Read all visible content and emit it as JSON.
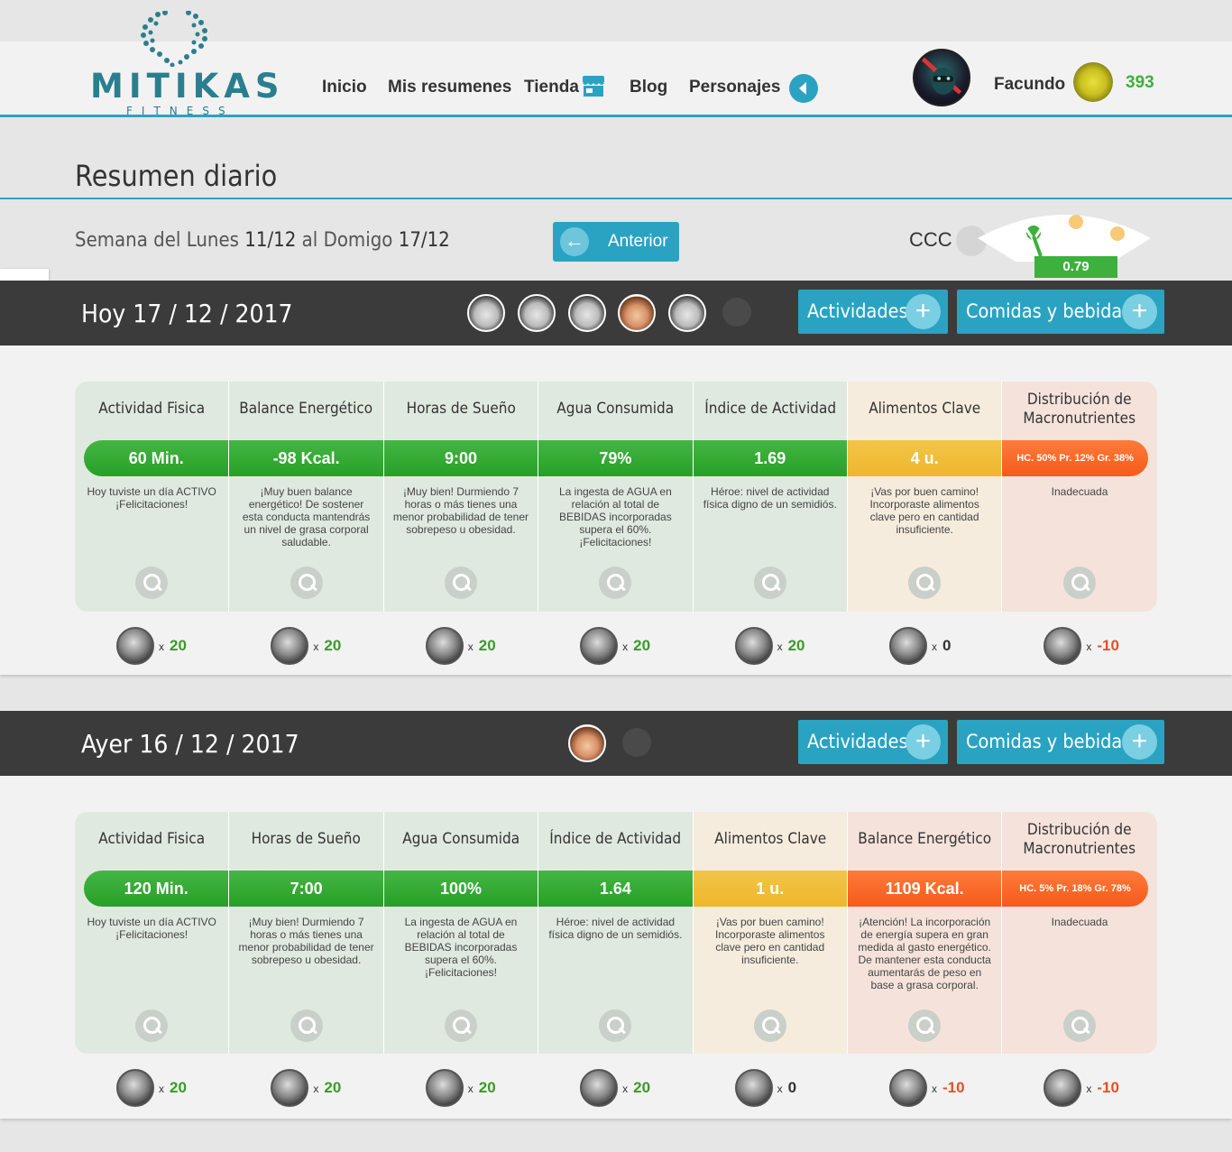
{
  "app": {
    "brand": "MITIKAS",
    "brand_sub": "FITNESS"
  },
  "nav": {
    "inicio": "Inicio",
    "resumenes": "Mis resumenes",
    "tienda": "Tienda",
    "blog": "Blog",
    "personajes": "Personajes"
  },
  "user": {
    "name": "Facundo",
    "coins": "393"
  },
  "page": {
    "title": "Resumen diario"
  },
  "week": {
    "prefix": "Semana del Lunes",
    "from": "11/12",
    "mid": "al Domigo",
    "to": "17/12"
  },
  "prev_button": "Anterior",
  "ccc": {
    "label": "CCC",
    "value": "0.79"
  },
  "buttons": {
    "actividades": "Actividades",
    "comidas": "Comidas y bebidas"
  },
  "days": [
    {
      "label": "Hoy",
      "date": "17 / 12 / 2017",
      "cards": [
        {
          "title": "Actividad Fisica",
          "value": "60 Min.",
          "desc": "Hoy tuviste un día ACTIVO ¡Felicitaciones!",
          "color": "g"
        },
        {
          "title": "Balance Energético",
          "value": "-98 Kcal.",
          "desc": "¡Muy buen balance energético! De sostener esta conducta mantendrás un nivel de grasa corporal saludable.",
          "color": "g"
        },
        {
          "title": "Horas de Sueño",
          "value": "9:00",
          "desc": "¡Muy bien! Durmiendo 7 horas o más tienes una menor probabilidad de tener sobrepeso u obesidad.",
          "color": "g"
        },
        {
          "title": "Agua Consumida",
          "value": "79%",
          "desc": "La ingesta de AGUA en relación al total de BEBIDAS incorporadas supera el 60%. ¡Felicitaciones!",
          "color": "g"
        },
        {
          "title": "Índice de Actividad",
          "value": "1.69",
          "desc": "Héroe: nivel de actividad física digno de un semidiós.",
          "color": "g"
        },
        {
          "title": "Alimentos Clave",
          "value": "4 u.",
          "desc": "¡Vas por buen camino! Incorporaste alimentos clave pero en cantidad insuficiente.",
          "color": "y"
        },
        {
          "title": "Distribución de Macronutrientes",
          "value": "HC. 50% Pr. 12% Gr. 38%",
          "desc": "Inadecuada",
          "color": "o"
        }
      ],
      "badges": [
        {
          "icon": "runner-icon",
          "points": "20"
        },
        {
          "icon": "scale-icon",
          "points": "20"
        },
        {
          "icon": "sleep-icon",
          "points": "20"
        },
        {
          "icon": "water-drop-icon",
          "points": "20"
        },
        {
          "icon": "activity-swirl-icon",
          "points": "20"
        },
        {
          "icon": "key-food-icon",
          "points": "0"
        },
        {
          "icon": "macro-icon",
          "points": "-10"
        }
      ]
    },
    {
      "label": "Ayer",
      "date": "16 / 12 / 2017",
      "cards": [
        {
          "title": "Actividad Fisica",
          "value": "120 Min.",
          "desc": "Hoy tuviste un día ACTIVO ¡Felicitaciones!",
          "color": "g"
        },
        {
          "title": "Horas de Sueño",
          "value": "7:00",
          "desc": "¡Muy bien! Durmiendo 7 horas o más tienes una menor probabilidad de tener sobrepeso u obesidad.",
          "color": "g"
        },
        {
          "title": "Agua Consumida",
          "value": "100%",
          "desc": "La ingesta de AGUA en relación al total de BEBIDAS incorporadas supera el 60%. ¡Felicitaciones!",
          "color": "g"
        },
        {
          "title": "Índice de Actividad",
          "value": "1.64",
          "desc": "Héroe: nivel de actividad física digno de un semidiós.",
          "color": "g"
        },
        {
          "title": "Alimentos Clave",
          "value": "1 u.",
          "desc": "¡Vas por buen camino! Incorporaste alimentos clave pero en cantidad insuficiente.",
          "color": "y"
        },
        {
          "title": "Balance Energético",
          "value": "1109 Kcal.",
          "desc": "¡Atención! La incorporación de energía supera en gran medida al gasto energético. De mantener esta conducta aumentarás de peso en base a grasa corporal.",
          "color": "o"
        },
        {
          "title": "Distribución de Macronutrientes",
          "value": "HC. 5% Pr. 18% Gr. 78%",
          "desc": "Inadecuada",
          "color": "o"
        }
      ],
      "badges": [
        {
          "icon": "runner-icon",
          "points": "20"
        },
        {
          "icon": "sleep-icon",
          "points": "20"
        },
        {
          "icon": "water-drop-icon",
          "points": "20"
        },
        {
          "icon": "activity-swirl-icon",
          "points": "20"
        },
        {
          "icon": "key-food-icon",
          "points": "0"
        },
        {
          "icon": "scale-icon",
          "points": "-10"
        },
        {
          "icon": "macro-icon",
          "points": "-10"
        }
      ]
    }
  ]
}
